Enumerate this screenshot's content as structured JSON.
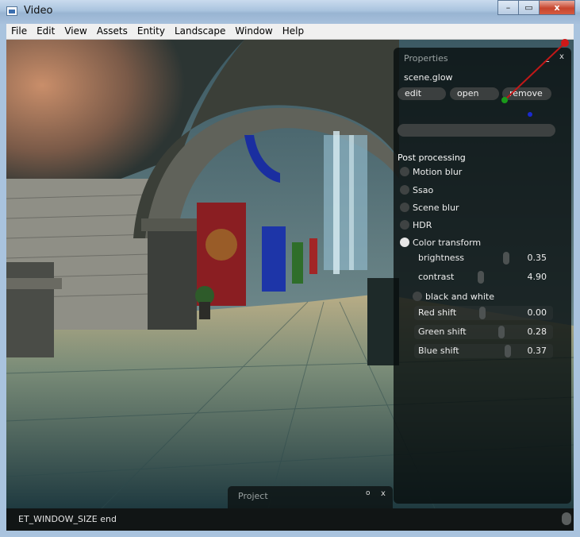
{
  "window": {
    "title": "Video",
    "controls": {
      "minimize": "–",
      "maximize": "▭",
      "close": "x"
    }
  },
  "menu": [
    "File",
    "Edit",
    "View",
    "Assets",
    "Entity",
    "Landscape",
    "Window",
    "Help"
  ],
  "properties": {
    "title": "Properties",
    "minimize": "_",
    "close": "x",
    "file_name": "scene.glow",
    "buttons": {
      "edit": "edit",
      "open": "open",
      "remove": "remove"
    },
    "name_input": "",
    "section": "Post processing",
    "effects": [
      {
        "label": "Motion blur",
        "checked": false
      },
      {
        "label": "Ssao",
        "checked": false
      },
      {
        "label": "Scene blur",
        "checked": false
      },
      {
        "label": "HDR",
        "checked": false
      },
      {
        "label": "Color transform",
        "checked": true
      }
    ],
    "color_transform": {
      "brightness": {
        "label": "brightness",
        "value": "0.35"
      },
      "contrast": {
        "label": "contrast",
        "value": "4.90"
      },
      "black_and_white": {
        "label": "black and white",
        "checked": false
      },
      "red_shift": {
        "label": "Red shift",
        "value": "0.00"
      },
      "green_shift": {
        "label": "Green shift",
        "value": "0.28"
      },
      "blue_shift": {
        "label": "Blue shift",
        "value": "0.37"
      }
    }
  },
  "project_panel": {
    "title": "Project",
    "minimize": "o",
    "close": "x"
  },
  "status": {
    "message": "ET_WINDOW_SIZE end"
  }
}
